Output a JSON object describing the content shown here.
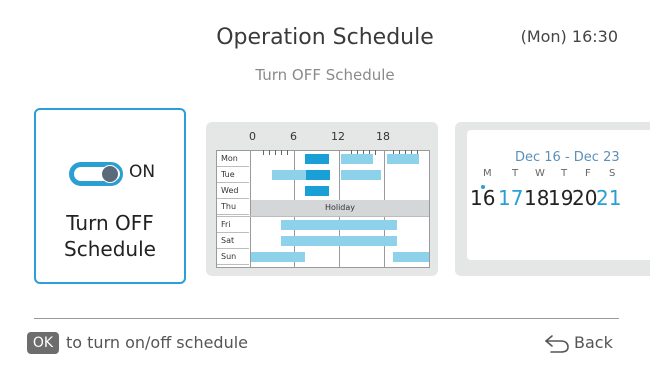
{
  "header": {
    "title": "Operation Schedule",
    "clock": "(Mon) 16:30",
    "subtitle": "Turn OFF Schedule"
  },
  "main_card": {
    "toggle_state": "ON",
    "label_line1": "Turn OFF",
    "label_line2": "Schedule"
  },
  "week_card": {
    "hour_ticks": [
      "0",
      "6",
      "12",
      "18"
    ],
    "days": [
      "Mon",
      "Tue",
      "Wed",
      "Thu",
      "Fri",
      "Sat",
      "Sun"
    ],
    "holiday_label": "Holiday"
  },
  "calendar_card": {
    "range": "Dec 16 - Dec 23",
    "weekdays": [
      "M",
      "T",
      "W",
      "T",
      "F",
      "S"
    ],
    "dates": [
      "16",
      "17",
      "18",
      "19",
      "20",
      "21"
    ]
  },
  "footer": {
    "ok_badge": "OK",
    "ok_hint": "to turn on/off schedule",
    "back_label": "Back"
  },
  "colors": {
    "accent": "#2a9fd6",
    "bar_light": "#8dd2ea",
    "card_bg": "#e5e6e6"
  }
}
